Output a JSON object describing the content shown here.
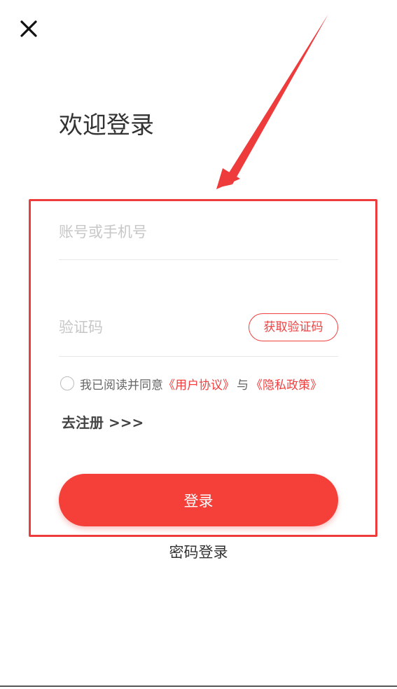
{
  "header": {
    "close_icon": "close-icon",
    "title": "欢迎登录"
  },
  "form": {
    "account_placeholder": "账号或手机号",
    "code_placeholder": "验证码",
    "get_code_label": "获取验证码",
    "agreement": {
      "prefix": "我已阅读并同意",
      "user_agreement": "《用户协议》",
      "conjunction": "与",
      "privacy_policy": "《隐私政策》"
    },
    "register_link": "去注册 >>>",
    "login_label": "登录",
    "password_login_label": "密码登录"
  },
  "colors": {
    "accent": "#f5403a",
    "annotation": "#ee3b3b"
  }
}
